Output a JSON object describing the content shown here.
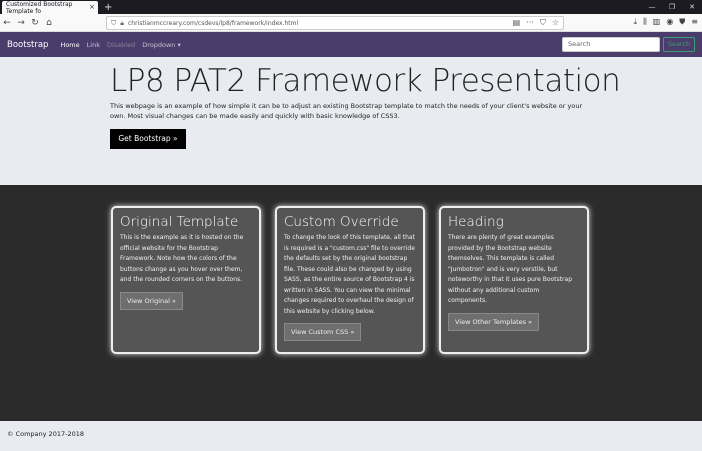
{
  "browser": {
    "tab_title": "Customized Bootstrap Template fo",
    "tab_close": "×",
    "new_tab": "+",
    "url": "christianmccreary.com/csdevs/lp8/framework/index.html",
    "window_controls": [
      "—",
      "❐",
      "✕"
    ]
  },
  "navbar": {
    "brand": "Bootstrap",
    "links": [
      {
        "label": "Home",
        "state": "active"
      },
      {
        "label": "Link",
        "state": "normal"
      },
      {
        "label": "Disabled",
        "state": "disabled"
      },
      {
        "label": "Dropdown ▾",
        "state": "normal"
      }
    ],
    "search_placeholder": "Search",
    "search_button": "Search"
  },
  "jumbotron": {
    "title": "LP8 PAT2 Framework Presentation",
    "text": "This webpage is an example of how simple it can be to adjust an existing Bootstrap template to match the needs of your client's website or your own. Most visual changes can be made easily and quickly with basic knowledge of CSS3.",
    "button": "Get Bootstrap »"
  },
  "cards": [
    {
      "title": "Original Template",
      "text": "This is the example as it is hosted on the official website for the Bootstrap Framework. Note how the colors of the buttons change as you hover over them, and the rounded corners on the buttons.",
      "button": "View Original »"
    },
    {
      "title": "Custom Override",
      "text": "To change the look of this template, all that is required is a \"custom.css\" file to override the defaults set by the original bootstrap file. These could also be changed by using SASS, as the entire source of Bootstrap 4 is written in SASS. You can view the minimal changes required to overhaul the design of this website by clicking below.",
      "button": "View Custom CSS »"
    },
    {
      "title": "Heading",
      "text": "There are plenty of great examples provided by the Bootstrap website themselves. This template is called \"Jumbotron\" and is very verstile, but noteworthy in that it uses pure Bootstrap without any additional custom components.",
      "button": "View Other Templates »"
    }
  ],
  "footer": {
    "text": "© Company 2017-2018"
  },
  "colors": {
    "navbar_bg": "#4a3c6b",
    "jumbotron_bg": "#e8ebef",
    "dark_section_bg": "#2b2b2b",
    "card_bg": "#555555",
    "search_button": "#3b9f73"
  }
}
